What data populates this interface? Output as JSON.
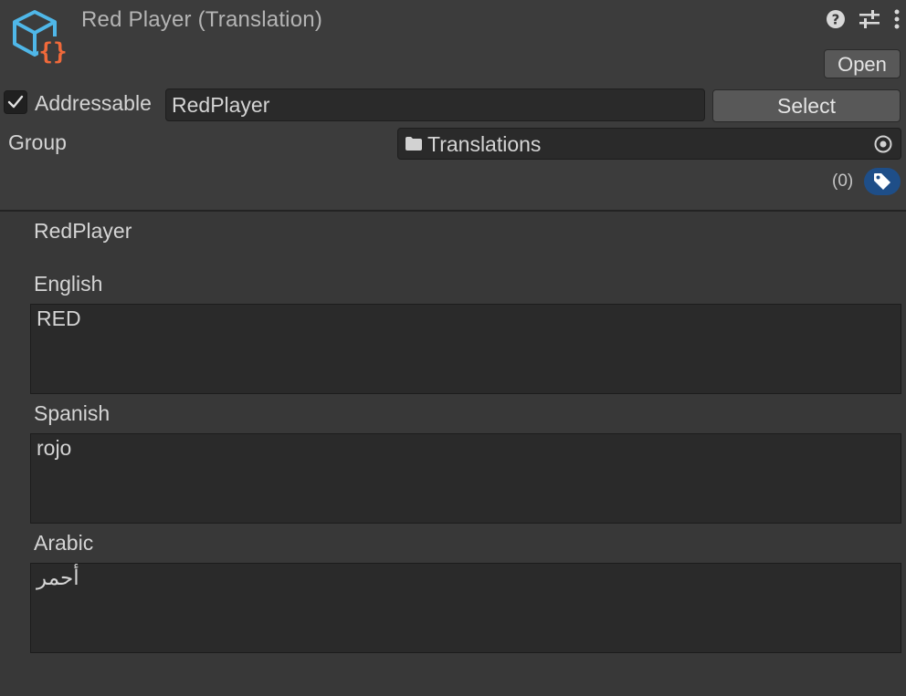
{
  "header": {
    "title": "Red Player (Translation)",
    "icons": [
      "asset-json-icon",
      "help-icon",
      "settings-sliders-icon",
      "more-menu-icon"
    ],
    "open_label": "Open",
    "addressable": {
      "checked": true,
      "label": "Addressable",
      "address": "RedPlayer",
      "select_label": "Select"
    },
    "group": {
      "label": "Group",
      "value": "Translations"
    },
    "labels_count": "(0)",
    "accent_color": "#1e4e88"
  },
  "content": {
    "key": "RedPlayer",
    "translations": [
      {
        "language": "English",
        "value": "RED"
      },
      {
        "language": "Spanish",
        "value": "rojo"
      },
      {
        "language": "Arabic",
        "value": "أحمر"
      }
    ]
  }
}
